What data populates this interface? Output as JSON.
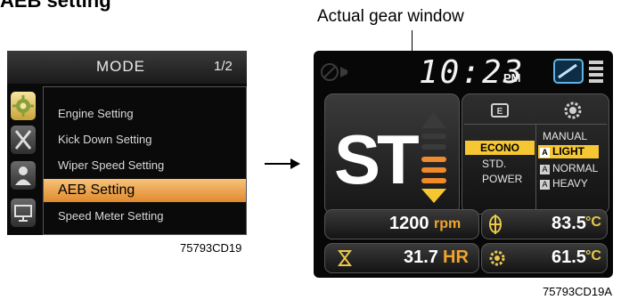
{
  "heading": {
    "section_title": "AEB setting",
    "callout": "Actual gear window"
  },
  "left_screen": {
    "title": "MODE",
    "page_indicator": "1/2",
    "menu_items": [
      "Engine Setting",
      "Kick Down Setting",
      "Wiper Speed Setting",
      "AEB Setting",
      "Speed Meter Setting"
    ],
    "selected_index": 3,
    "side_icons": [
      "gear-icon",
      "wrench-icon",
      "user-icon",
      "monitor-icon"
    ],
    "figure_label": "75793CD19"
  },
  "right_screen": {
    "clock": "10:23",
    "ampm": "PM",
    "gear": "ST",
    "power_modes": [
      "ECONO",
      "STD.",
      "POWER"
    ],
    "active_power_mode": "ECONO",
    "transmission_modes": [
      "MANUAL",
      "LIGHT",
      "NORMAL",
      "HEAVY"
    ],
    "active_transmission_mode": "LIGHT",
    "engine_speed": {
      "value": "1200",
      "unit": "rpm"
    },
    "hour_meter": {
      "value": "31.7",
      "unit": "HR"
    },
    "temp_1": {
      "value": "83.5",
      "unit": "°C"
    },
    "temp_2": {
      "value": "61.5",
      "unit": "°C"
    },
    "figure_label": "75793CD19A"
  },
  "colors": {
    "accent_orange": "#f2a52b",
    "highlight_yellow": "#f6c733",
    "screen_bg": "#070707"
  }
}
